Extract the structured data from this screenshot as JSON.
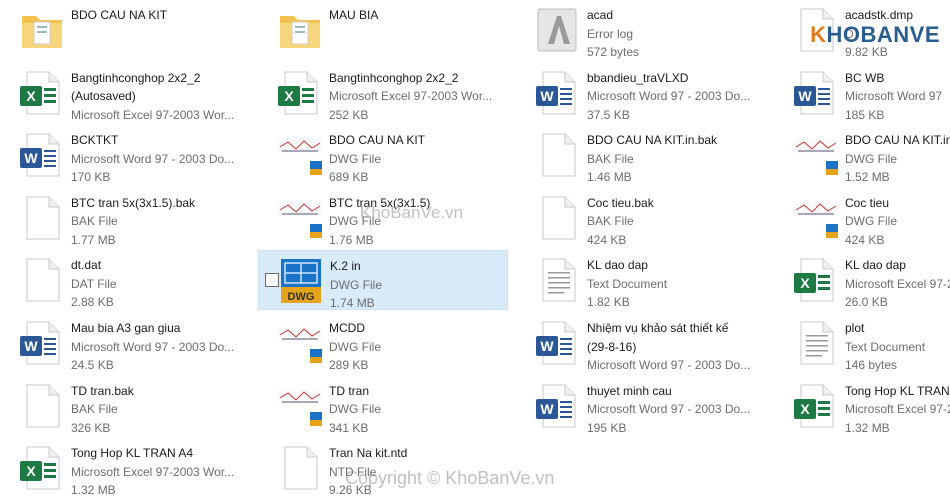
{
  "files": [
    {
      "name": "BDO CAU NA KIT",
      "type": "",
      "size": "",
      "icon": "folder-icon"
    },
    {
      "name": "MAU BIA",
      "type": "",
      "size": "",
      "icon": "folder-icon"
    },
    {
      "name": "acad",
      "type": "Error log",
      "size": "572 bytes",
      "icon": "autocad-log-icon"
    },
    {
      "name": "acadstk.dmp",
      "type": "D",
      "size": "9.82 KB",
      "icon": "generic-file-icon"
    },
    {
      "name": "Bangtinhconghop 2x2_2",
      "name2": "(Autosaved)",
      "type": "Microsoft Excel 97-2003 Wor...",
      "size": "",
      "icon": "excel-icon"
    },
    {
      "name": "Bangtinhconghop 2x2_2",
      "type": "Microsoft Excel 97-2003 Wor...",
      "size": "252 KB",
      "icon": "excel-icon"
    },
    {
      "name": "bbandieu_traVLXD",
      "type": "Microsoft Word 97 - 2003 Do...",
      "size": "37.5 KB",
      "icon": "word-icon"
    },
    {
      "name": "BC WB",
      "type": "Microsoft Word 97",
      "size": "185 KB",
      "icon": "word-icon"
    },
    {
      "name": "BCKTKT",
      "type": "Microsoft Word 97 - 2003 Do...",
      "size": "170 KB",
      "icon": "word-icon"
    },
    {
      "name": "BDO CAU NA KIT",
      "type": "DWG File",
      "size": "689 KB",
      "icon": "dwg-thumb-icon"
    },
    {
      "name": "BDO CAU NA KIT.in.bak",
      "type": "BAK File",
      "size": "1.46 MB",
      "icon": "generic-file-icon"
    },
    {
      "name": "BDO CAU NA KIT.in",
      "type": "DWG File",
      "size": "1.52 MB",
      "icon": "dwg-thumb-icon"
    },
    {
      "name": "BTC tran 5x(3x1.5).bak",
      "type": "BAK File",
      "size": "1.77 MB",
      "icon": "generic-file-icon"
    },
    {
      "name": "BTC tran 5x(3x1.5)",
      "type": "DWG File",
      "size": "1.76 MB",
      "icon": "dwg-thumb-icon"
    },
    {
      "name": "Coc tieu.bak",
      "type": "BAK File",
      "size": "424 KB",
      "icon": "generic-file-icon"
    },
    {
      "name": "Coc tieu",
      "type": "DWG File",
      "size": "424 KB",
      "icon": "dwg-thumb-icon"
    },
    {
      "name": "dt.dat",
      "type": "DAT File",
      "size": "2.88 KB",
      "icon": "generic-file-icon"
    },
    {
      "name": "K.2 in",
      "type": "DWG File",
      "size": "1.74 MB",
      "icon": "dwg-icon"
    },
    {
      "name": "KL dao dap",
      "type": "Text Document",
      "size": "1.82 KB",
      "icon": "text-doc-icon"
    },
    {
      "name": "KL dao dap",
      "type": "Microsoft Excel 97-2",
      "size": "26.0 KB",
      "icon": "excel-icon"
    },
    {
      "name": "Mau bia A3 gan giua",
      "type": "Microsoft Word 97 - 2003 Do...",
      "size": "24.5 KB",
      "icon": "word-icon"
    },
    {
      "name": "MCDD",
      "type": "DWG File",
      "size": "289 KB",
      "icon": "dwg-thumb-icon"
    },
    {
      "name": "Nhiệm vụ khảo sát thiết kế",
      "name2": "(29-8-16)",
      "type": "Microsoft Word 97 - 2003 Do...",
      "size": "",
      "icon": "word-icon"
    },
    {
      "name": "plot",
      "type": "Text Document",
      "size": "146 bytes",
      "icon": "text-doc-icon"
    },
    {
      "name": "TD tran.bak",
      "type": "BAK File",
      "size": "326 KB",
      "icon": "generic-file-icon"
    },
    {
      "name": "TD tran",
      "type": "DWG File",
      "size": "341 KB",
      "icon": "dwg-thumb-icon"
    },
    {
      "name": "thuyet minh cau",
      "type": "Microsoft Word 97 - 2003 Do...",
      "size": "195 KB",
      "icon": "word-icon"
    },
    {
      "name": "Tong Hop KL TRAN",
      "type": "Microsoft Excel 97-2",
      "size": "1.32 MB",
      "icon": "excel-icon"
    },
    {
      "name": "Tong Hop KL TRAN A4",
      "type": "Microsoft Excel 97-2003 Wor...",
      "size": "1.32 MB",
      "icon": "excel-icon"
    },
    {
      "name": "Tran Na kit.ntd",
      "type": "NTD File",
      "size": "9.26 KB",
      "icon": "generic-file-icon"
    }
  ],
  "watermark": {
    "center": "KhoBanVe.vn",
    "bottom": "Copyright © KhoBanVe.vn",
    "brand_prefix": "K",
    "brand_rest": "HOBANVE"
  },
  "colors": {
    "selected": "#d9ebf9",
    "excel": "#1d7a45",
    "word": "#2b5797",
    "folder": "#f2c14e",
    "dwg_blue": "#1a73c7",
    "dwg_gold": "#e5a21b"
  }
}
